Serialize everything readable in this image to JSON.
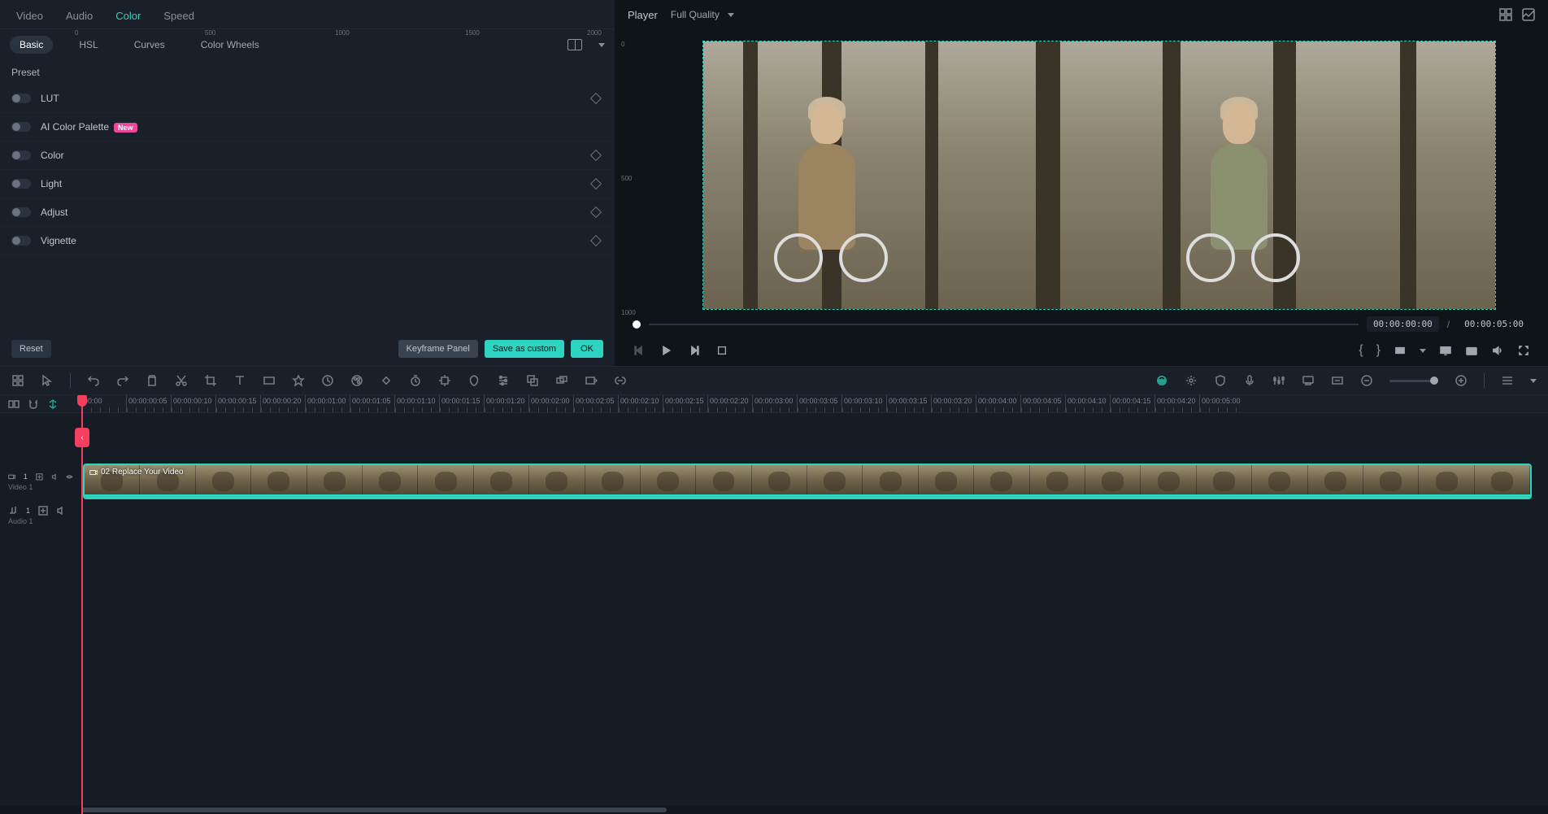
{
  "mainTabs": {
    "video": "Video",
    "audio": "Audio",
    "color": "Color",
    "speed": "Speed",
    "active": "Color"
  },
  "subTabs": {
    "basic": "Basic",
    "hsl": "HSL",
    "curves": "Curves",
    "wheels": "Color Wheels",
    "active": "Basic"
  },
  "presetLabel": "Preset",
  "colorItems": {
    "lut": "LUT",
    "aiPalette": "AI Color Palette",
    "aiBadge": "New",
    "color": "Color",
    "light": "Light",
    "adjust": "Adjust",
    "vignette": "Vignette"
  },
  "leftFooter": {
    "reset": "Reset",
    "keyframe": "Keyframe Panel",
    "save": "Save as custom",
    "ok": "OK"
  },
  "player": {
    "label": "Player",
    "quality": "Full Quality",
    "rulerH": {
      "r0": "0",
      "r500": "500",
      "r1000": "1000",
      "r1500": "1500",
      "r2000": "2000"
    },
    "rulerV": {
      "v0": "0",
      "v500": "500",
      "v1000": "1000"
    },
    "currentTime": "00:00:00:00",
    "totalTime": "00:00:05:00",
    "sep": "/"
  },
  "timeline": {
    "ticks": [
      "00:00",
      "00:00:00:05",
      "00:00:00:10",
      "00:00:00:15",
      "00:00:00:20",
      "00:00:01:00",
      "00:00:01:05",
      "00:00:01:10",
      "00:00:01:15",
      "00:00:01:20",
      "00:00:02:00",
      "00:00:02:05",
      "00:00:02:10",
      "00:00:02:15",
      "00:00:02:20",
      "00:00:03:00",
      "00:00:03:05",
      "00:00:03:10",
      "00:00:03:15",
      "00:00:03:20",
      "00:00:04:00",
      "00:00:04:05",
      "00:00:04:10",
      "00:00:04:15",
      "00:00:04:20",
      "00:00:05:00"
    ],
    "video1": "Video 1",
    "audio1": "Audio 1",
    "clipLabel": "02 Replace Your Video"
  }
}
